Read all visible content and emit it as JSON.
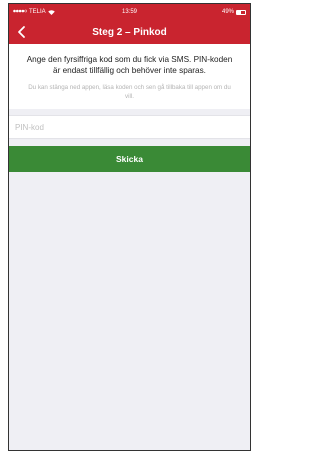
{
  "status_bar": {
    "carrier": "TELIA",
    "time": "13:59",
    "battery": "49%",
    "battery_level": 0.49,
    "icons": [
      "signal-dots-icon",
      "wifi-icon",
      "battery-icon"
    ]
  },
  "nav": {
    "title": "Steg 2 – Pinkod",
    "back_icon": "chevron-left-icon"
  },
  "instructions": {
    "main": "Ange den fyrsiffriga kod som du fick via SMS. PIN-koden är endast tillfällig och behöver inte sparas.",
    "sub": "Du kan stänga ned appen, läsa koden och sen gå tillbaka till appen om du vill."
  },
  "pin_field": {
    "placeholder": "PIN-kod",
    "value": ""
  },
  "send_button": {
    "label": "Skicka"
  },
  "colors": {
    "brand_red": "#c9242f",
    "button_green": "#3a8a36",
    "background": "#efeff4"
  }
}
